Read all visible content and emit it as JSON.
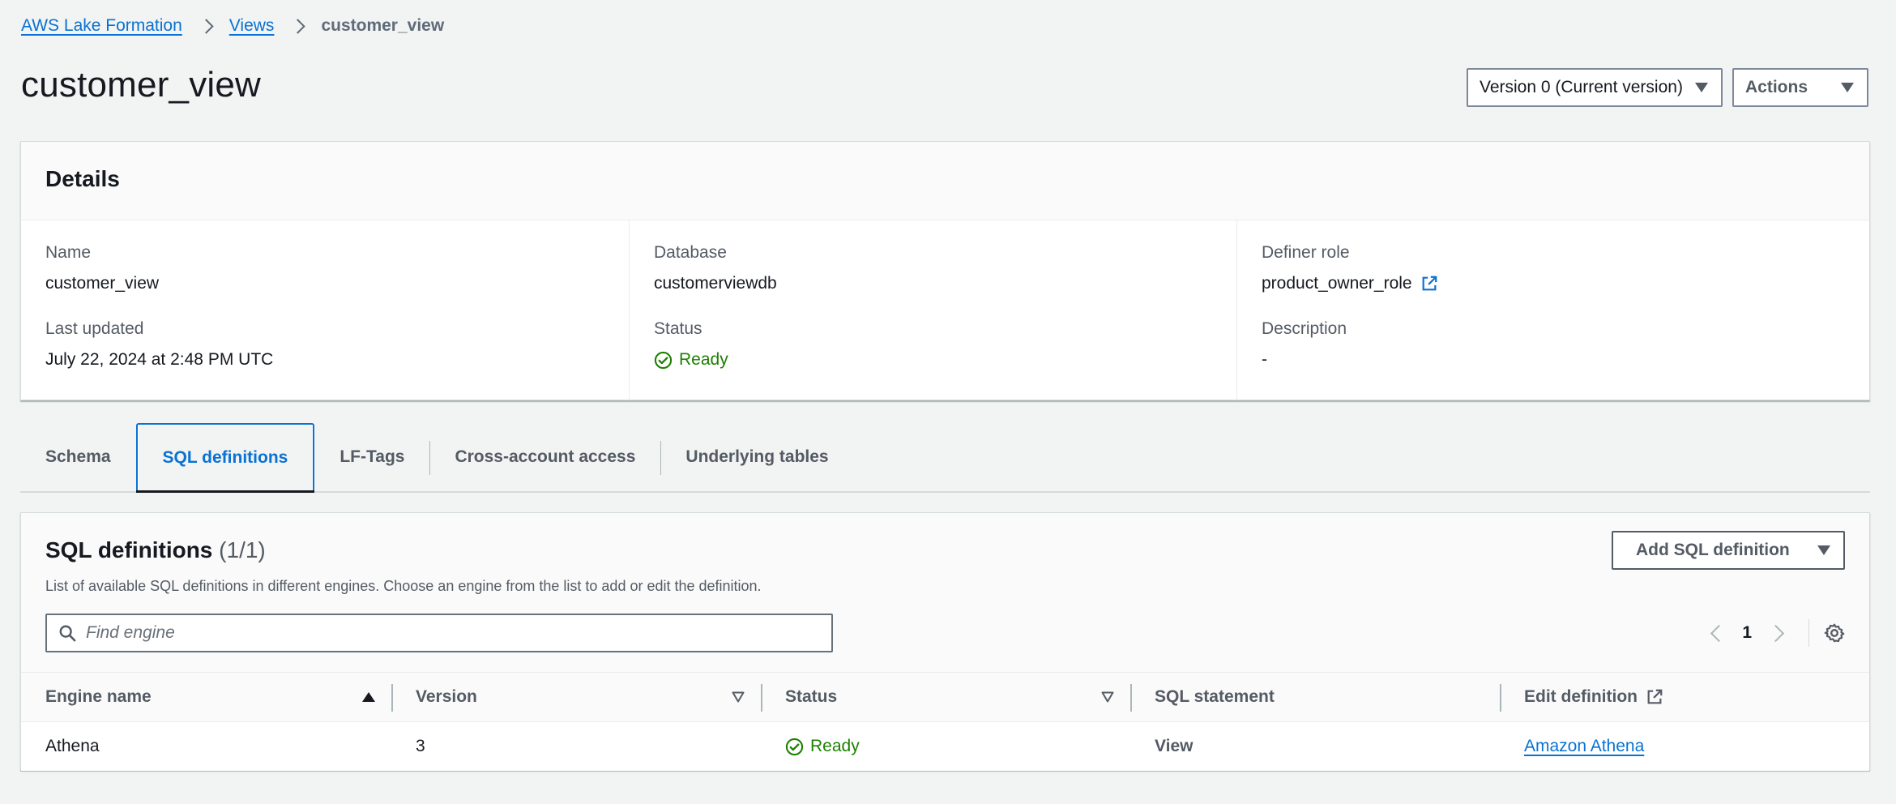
{
  "breadcrumb": {
    "root": "AWS Lake Formation",
    "views": "Views",
    "current": "customer_view"
  },
  "page": {
    "title": "customer_view",
    "version_select": "Version 0 (Current version)",
    "actions_label": "Actions"
  },
  "details": {
    "title": "Details",
    "name_label": "Name",
    "name_value": "customer_view",
    "last_updated_label": "Last updated",
    "last_updated_value": "July 22, 2024 at 2:48 PM UTC",
    "database_label": "Database",
    "database_value": "customerviewdb",
    "status_label": "Status",
    "status_value": "Ready",
    "definer_role_label": "Definer role",
    "definer_role_value": "product_owner_role",
    "description_label": "Description",
    "description_value": "-"
  },
  "tabs": [
    {
      "label": "Schema"
    },
    {
      "label": "SQL definitions"
    },
    {
      "label": "LF-Tags"
    },
    {
      "label": "Cross-account access"
    },
    {
      "label": "Underlying tables"
    }
  ],
  "sql_definitions": {
    "title": "SQL definitions",
    "count": "(1/1)",
    "description": "List of available SQL definitions in different engines. Choose an engine from the list to add or edit the definition.",
    "add_button": "Add SQL definition",
    "search_placeholder": "Find engine",
    "current_page": "1",
    "columns": [
      "Engine name",
      "Version",
      "Status",
      "SQL statement",
      "Edit definition"
    ],
    "rows": [
      {
        "engine": "Athena",
        "version": "3",
        "status": "Ready",
        "sql_statement": "View",
        "edit_link": "Amazon Athena"
      }
    ]
  },
  "colors": {
    "link": "#0972d3",
    "success": "#1d8102",
    "text": "#16191f",
    "muted": "#545b64"
  }
}
